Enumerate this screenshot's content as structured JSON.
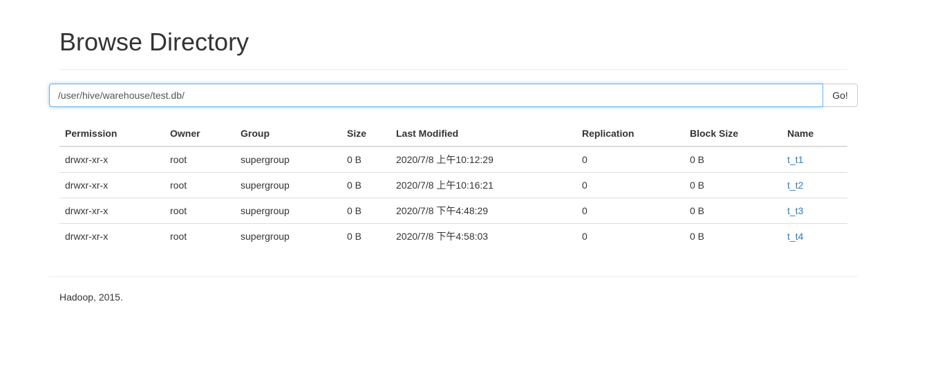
{
  "header": {
    "title": "Browse Directory"
  },
  "search": {
    "path_value": "/user/hive/warehouse/test.db/",
    "go_label": "Go!"
  },
  "table": {
    "columns": [
      "Permission",
      "Owner",
      "Group",
      "Size",
      "Last Modified",
      "Replication",
      "Block Size",
      "Name"
    ],
    "rows": [
      {
        "permission": "drwxr-xr-x",
        "owner": "root",
        "group": "supergroup",
        "size": "0 B",
        "last_modified": "2020/7/8 上午10:12:29",
        "replication": "0",
        "block_size": "0 B",
        "name": "t_t1"
      },
      {
        "permission": "drwxr-xr-x",
        "owner": "root",
        "group": "supergroup",
        "size": "0 B",
        "last_modified": "2020/7/8 上午10:16:21",
        "replication": "0",
        "block_size": "0 B",
        "name": "t_t2"
      },
      {
        "permission": "drwxr-xr-x",
        "owner": "root",
        "group": "supergroup",
        "size": "0 B",
        "last_modified": "2020/7/8 下午4:48:29",
        "replication": "0",
        "block_size": "0 B",
        "name": "t_t3"
      },
      {
        "permission": "drwxr-xr-x",
        "owner": "root",
        "group": "supergroup",
        "size": "0 B",
        "last_modified": "2020/7/8 下午4:58:03",
        "replication": "0",
        "block_size": "0 B",
        "name": "t_t4"
      }
    ]
  },
  "footer": {
    "text": "Hadoop, 2015."
  },
  "colors": {
    "link": "#337ab7",
    "focus_border": "#66afe9",
    "text": "#333333"
  }
}
